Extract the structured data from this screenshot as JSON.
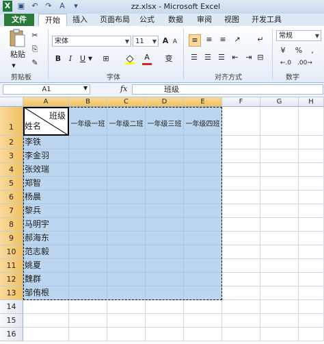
{
  "window": {
    "title": "zz.xlsx - Microsoft Excel"
  },
  "tabs": [
    "文件",
    "开始",
    "插入",
    "页面布局",
    "公式",
    "数据",
    "审阅",
    "视图",
    "开发工具"
  ],
  "ribbon": {
    "clipboard": {
      "label": "剪贴板",
      "paste": "粘贴"
    },
    "font": {
      "label": "字体",
      "name": "宋体",
      "size": "11",
      "bold": "B",
      "italic": "I",
      "underline": "U",
      "grow": "A",
      "shrink": "A",
      "fontcolor": "A",
      "phonetic": "变"
    },
    "alignment": {
      "label": "对齐方式"
    },
    "number": {
      "label": "数字",
      "format": "常规",
      "percent": "%",
      "comma": ","
    }
  },
  "formula_bar": {
    "name_box": "A1",
    "fx": "fx",
    "content": "班级"
  },
  "columns": [
    "A",
    "B",
    "C",
    "D",
    "E",
    "F",
    "G",
    "H"
  ],
  "rows": [
    "1",
    "2",
    "3",
    "4",
    "5",
    "6",
    "7",
    "8",
    "9",
    "10",
    "11",
    "12",
    "13",
    "14",
    "15",
    "16"
  ],
  "sheet": {
    "a1_top": "班级",
    "a1_bottom": "姓名",
    "headers": [
      "一年级一班",
      "一年级二班",
      "一年级三班",
      "一年级四班"
    ],
    "names": [
      "李铁",
      "李金羽",
      "张效瑞",
      "郑智",
      "杨晨",
      "黎兵",
      "马明宇",
      "郝海东",
      "范志毅",
      "姚夏",
      "魏群",
      "邹侑根"
    ]
  }
}
